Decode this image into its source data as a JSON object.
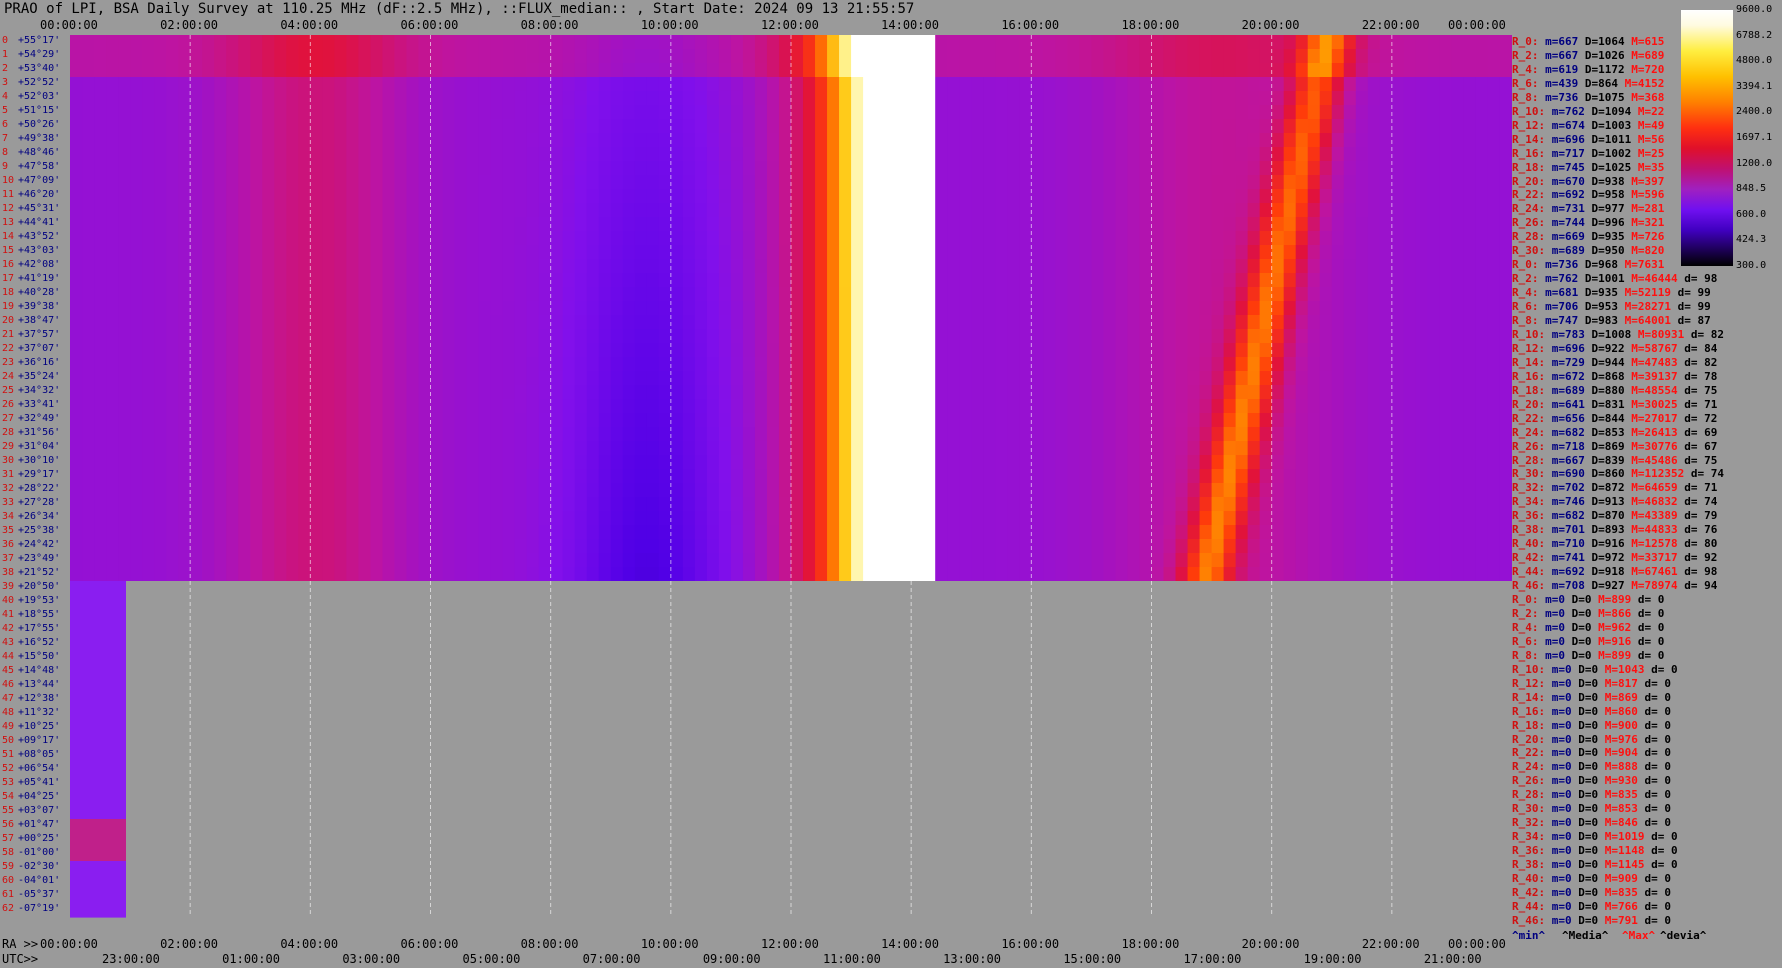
{
  "title": "PRAO of LPI, BSA Daily Survey at 110.25 MHz (dF::2.5 MHz), ::FLUX_median:: , Start Date: 2024 09 13 21:55:57",
  "axis": {
    "top_times": [
      "00:00:00",
      "02:00:00",
      "04:00:00",
      "06:00:00",
      "08:00:00",
      "10:00:00",
      "12:00:00",
      "14:00:00",
      "16:00:00",
      "18:00:00",
      "20:00:00",
      "22:00:00",
      "00:00:00"
    ],
    "bottom_ra_times": [
      "00:00:00",
      "02:00:00",
      "04:00:00",
      "06:00:00",
      "08:00:00",
      "10:00:00",
      "12:00:00",
      "14:00:00",
      "16:00:00",
      "18:00:00",
      "20:00:00",
      "22:00:00",
      "00:00:00"
    ],
    "bottom_utc_times": [
      "23:00:00",
      "01:00:00",
      "03:00:00",
      "05:00:00",
      "07:00:00",
      "09:00:00",
      "11:00:00",
      "13:00:00",
      "15:00:00",
      "17:00:00",
      "19:00:00",
      "21:00:00"
    ],
    "ra_label": "RA >>",
    "utc_label": "UTC>>"
  },
  "colorbar_ticks": [
    "9600.0",
    "6788.2",
    "4800.0",
    "3394.1",
    "2400.0",
    "1697.1",
    "1200.0",
    "848.5",
    "600.0",
    "424.3",
    "300.0"
  ],
  "rows": [
    {
      "i": "0",
      "dec": "+55°17'"
    },
    {
      "i": "1",
      "dec": "+54°29'"
    },
    {
      "i": "2",
      "dec": "+53°40'"
    },
    {
      "i": "3",
      "dec": "+52°52'"
    },
    {
      "i": "4",
      "dec": "+52°03'"
    },
    {
      "i": "5",
      "dec": "+51°15'"
    },
    {
      "i": "6",
      "dec": "+50°26'"
    },
    {
      "i": "7",
      "dec": "+49°38'"
    },
    {
      "i": "8",
      "dec": "+48°46'"
    },
    {
      "i": "9",
      "dec": "+47°58'"
    },
    {
      "i": "10",
      "dec": "+47°09'"
    },
    {
      "i": "11",
      "dec": "+46°20'"
    },
    {
      "i": "12",
      "dec": "+45°31'"
    },
    {
      "i": "13",
      "dec": "+44°41'"
    },
    {
      "i": "14",
      "dec": "+43°52'"
    },
    {
      "i": "15",
      "dec": "+43°03'"
    },
    {
      "i": "16",
      "dec": "+42°08'"
    },
    {
      "i": "17",
      "dec": "+41°19'"
    },
    {
      "i": "18",
      "dec": "+40°28'"
    },
    {
      "i": "19",
      "dec": "+39°38'"
    },
    {
      "i": "20",
      "dec": "+38°47'"
    },
    {
      "i": "21",
      "dec": "+37°57'"
    },
    {
      "i": "22",
      "dec": "+37°07'"
    },
    {
      "i": "23",
      "dec": "+36°16'"
    },
    {
      "i": "24",
      "dec": "+35°24'"
    },
    {
      "i": "25",
      "dec": "+34°32'"
    },
    {
      "i": "26",
      "dec": "+33°41'"
    },
    {
      "i": "27",
      "dec": "+32°49'"
    },
    {
      "i": "28",
      "dec": "+31°56'"
    },
    {
      "i": "29",
      "dec": "+31°04'"
    },
    {
      "i": "30",
      "dec": "+30°10'"
    },
    {
      "i": "31",
      "dec": "+29°17'"
    },
    {
      "i": "32",
      "dec": "+28°22'"
    },
    {
      "i": "33",
      "dec": "+27°28'"
    },
    {
      "i": "34",
      "dec": "+26°34'"
    },
    {
      "i": "35",
      "dec": "+25°38'"
    },
    {
      "i": "36",
      "dec": "+24°42'"
    },
    {
      "i": "37",
      "dec": "+23°49'"
    },
    {
      "i": "38",
      "dec": "+21°52'"
    },
    {
      "i": "39",
      "dec": "+20°50'"
    },
    {
      "i": "40",
      "dec": "+19°53'"
    },
    {
      "i": "41",
      "dec": "+18°55'"
    },
    {
      "i": "42",
      "dec": "+17°55'"
    },
    {
      "i": "43",
      "dec": "+16°52'"
    },
    {
      "i": "44",
      "dec": "+15°50'"
    },
    {
      "i": "45",
      "dec": "+14°48'"
    },
    {
      "i": "46",
      "dec": "+13°44'"
    },
    {
      "i": "47",
      "dec": "+12°38'"
    },
    {
      "i": "48",
      "dec": "+11°32'"
    },
    {
      "i": "49",
      "dec": "+10°25'"
    },
    {
      "i": "50",
      "dec": "+09°17'"
    },
    {
      "i": "51",
      "dec": "+08°05'"
    },
    {
      "i": "52",
      "dec": "+06°54'"
    },
    {
      "i": "53",
      "dec": "+05°41'"
    },
    {
      "i": "54",
      "dec": "+04°25'"
    },
    {
      "i": "55",
      "dec": "+03°07'"
    },
    {
      "i": "56",
      "dec": "+01°47'"
    },
    {
      "i": "57",
      "dec": "+00°25'"
    },
    {
      "i": "58",
      "dec": "-01°00'"
    },
    {
      "i": "59",
      "dec": "-02°30'"
    },
    {
      "i": "60",
      "dec": "-04°01'"
    },
    {
      "i": "61",
      "dec": "-05°37'"
    },
    {
      "i": "62",
      "dec": "-07°19'"
    }
  ],
  "stats": [
    [
      "R_0:",
      "m=667",
      "D=1064",
      "M=615",
      ""
    ],
    [
      "R_2:",
      "m=667",
      "D=1026",
      "M=689",
      ""
    ],
    [
      "R_4:",
      "m=619",
      "D=1172",
      "M=720",
      ""
    ],
    [
      "R_6:",
      "m=439",
      "D=864",
      "M=4152",
      ""
    ],
    [
      "R_8:",
      "m=736",
      "D=1075",
      "M=368",
      ""
    ],
    [
      "R_10:",
      "m=762",
      "D=1094",
      "M=22",
      ""
    ],
    [
      "R_12:",
      "m=674",
      "D=1003",
      "M=49",
      ""
    ],
    [
      "R_14:",
      "m=696",
      "D=1011",
      "M=56",
      ""
    ],
    [
      "R_16:",
      "m=717",
      "D=1002",
      "M=25",
      ""
    ],
    [
      "R_18:",
      "m=745",
      "D=1025",
      "M=35",
      ""
    ],
    [
      "R_20:",
      "m=670",
      "D=938",
      "M=397",
      ""
    ],
    [
      "R_22:",
      "m=692",
      "D=958",
      "M=596",
      ""
    ],
    [
      "R_24:",
      "m=731",
      "D=977",
      "M=281",
      ""
    ],
    [
      "R_26:",
      "m=744",
      "D=996",
      "M=321",
      ""
    ],
    [
      "R_28:",
      "m=669",
      "D=935",
      "M=726",
      ""
    ],
    [
      "R_30:",
      "m=689",
      "D=950",
      "M=820",
      ""
    ],
    [
      "R_0:",
      "m=736",
      "D=968",
      "M=7631",
      ""
    ],
    [
      "R_2:",
      "m=762",
      "D=1001",
      "M=46444",
      "d= 98"
    ],
    [
      "R_4:",
      "m=681",
      "D=935",
      "M=52119",
      "d= 99"
    ],
    [
      "R_6:",
      "m=706",
      "D=953",
      "M=28271",
      "d= 99"
    ],
    [
      "R_8:",
      "m=747",
      "D=983",
      "M=64001",
      "d= 87"
    ],
    [
      "R_10:",
      "m=783",
      "D=1008",
      "M=80931",
      "d= 82"
    ],
    [
      "R_12:",
      "m=696",
      "D=922",
      "M=58767",
      "d= 84"
    ],
    [
      "R_14:",
      "m=729",
      "D=944",
      "M=47483",
      "d= 82"
    ],
    [
      "R_16:",
      "m=672",
      "D=868",
      "M=39137",
      "d= 78"
    ],
    [
      "R_18:",
      "m=689",
      "D=880",
      "M=48554",
      "d= 75"
    ],
    [
      "R_20:",
      "m=641",
      "D=831",
      "M=30025",
      "d= 71"
    ],
    [
      "R_22:",
      "m=656",
      "D=844",
      "M=27017",
      "d= 72"
    ],
    [
      "R_24:",
      "m=682",
      "D=853",
      "M=26413",
      "d= 69"
    ],
    [
      "R_26:",
      "m=718",
      "D=869",
      "M=30776",
      "d= 67"
    ],
    [
      "R_28:",
      "m=667",
      "D=839",
      "M=45486",
      "d= 75"
    ],
    [
      "R_30:",
      "m=690",
      "D=860",
      "M=112352",
      "d= 74"
    ],
    [
      "R_32:",
      "m=702",
      "D=872",
      "M=64659",
      "d= 71"
    ],
    [
      "R_34:",
      "m=746",
      "D=913",
      "M=46832",
      "d= 74"
    ],
    [
      "R_36:",
      "m=682",
      "D=870",
      "M=43389",
      "d= 79"
    ],
    [
      "R_38:",
      "m=701",
      "D=893",
      "M=44833",
      "d= 76"
    ],
    [
      "R_40:",
      "m=710",
      "D=916",
      "M=12578",
      "d= 80"
    ],
    [
      "R_42:",
      "m=741",
      "D=972",
      "M=33717",
      "d= 92"
    ],
    [
      "R_44:",
      "m=692",
      "D=918",
      "M=67461",
      "d= 98"
    ],
    [
      "R_46:",
      "m=708",
      "D=927",
      "M=78974",
      "d= 94"
    ],
    [
      "R_0:",
      "m=0",
      "D=0",
      "M=899",
      "d= 0"
    ],
    [
      "R_2:",
      "m=0",
      "D=0",
      "M=866",
      "d= 0"
    ],
    [
      "R_4:",
      "m=0",
      "D=0",
      "M=962",
      "d= 0"
    ],
    [
      "R_6:",
      "m=0",
      "D=0",
      "M=916",
      "d= 0"
    ],
    [
      "R_8:",
      "m=0",
      "D=0",
      "M=899",
      "d= 0"
    ],
    [
      "R_10:",
      "m=0",
      "D=0",
      "M=1043",
      "d= 0"
    ],
    [
      "R_12:",
      "m=0",
      "D=0",
      "M=817",
      "d= 0"
    ],
    [
      "R_14:",
      "m=0",
      "D=0",
      "M=869",
      "d= 0"
    ],
    [
      "R_16:",
      "m=0",
      "D=0",
      "M=860",
      "d= 0"
    ],
    [
      "R_18:",
      "m=0",
      "D=0",
      "M=900",
      "d= 0"
    ],
    [
      "R_20:",
      "m=0",
      "D=0",
      "M=976",
      "d= 0"
    ],
    [
      "R_22:",
      "m=0",
      "D=0",
      "M=904",
      "d= 0"
    ],
    [
      "R_24:",
      "m=0",
      "D=0",
      "M=888",
      "d= 0"
    ],
    [
      "R_26:",
      "m=0",
      "D=0",
      "M=930",
      "d= 0"
    ],
    [
      "R_28:",
      "m=0",
      "D=0",
      "M=835",
      "d= 0"
    ],
    [
      "R_30:",
      "m=0",
      "D=0",
      "M=853",
      "d= 0"
    ],
    [
      "R_32:",
      "m=0",
      "D=0",
      "M=846",
      "d= 0"
    ],
    [
      "R_34:",
      "m=0",
      "D=0",
      "M=1019",
      "d= 0"
    ],
    [
      "R_36:",
      "m=0",
      "D=0",
      "M=1148",
      "d= 0"
    ],
    [
      "R_38:",
      "m=0",
      "D=0",
      "M=1145",
      "d= 0"
    ],
    [
      "R_40:",
      "m=0",
      "D=0",
      "M=909",
      "d= 0"
    ],
    [
      "R_42:",
      "m=0",
      "D=0",
      "M=835",
      "d= 0"
    ],
    [
      "R_44:",
      "m=0",
      "D=0",
      "M=766",
      "d= 0"
    ],
    [
      "R_46:",
      "m=0",
      "D=0",
      "M=791",
      "d= 0"
    ]
  ],
  "legend": {
    "min": "^min^",
    "median": "^Media^",
    "max": "^Max^",
    "devia": "^devia^"
  },
  "colors": {
    "background": "#9a9a9a",
    "label_red": "#d01010",
    "label_blue": "#000080"
  }
}
